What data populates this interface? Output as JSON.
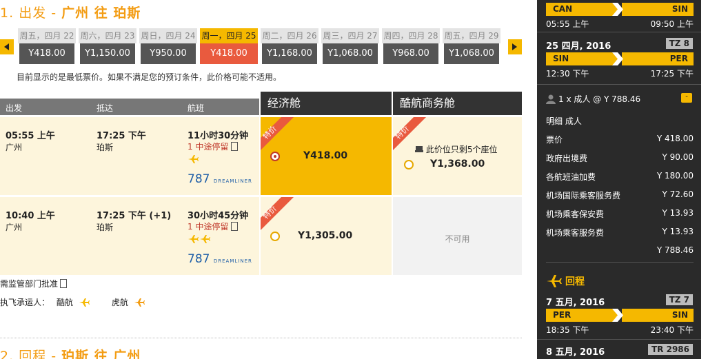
{
  "outbound": {
    "num": "1.",
    "label": "出发 - ",
    "route": "广州 往 珀斯",
    "dates": [
      {
        "day": "周五，四月 22",
        "price": "Y418.00",
        "selected": false
      },
      {
        "day": "周六，四月 23",
        "price": "Y1,150.00",
        "selected": false
      },
      {
        "day": "周日，四月 24",
        "price": "Y950.00",
        "selected": false
      },
      {
        "day": "周一，四月 25",
        "price": "Y418.00",
        "selected": true
      },
      {
        "day": "周二，四月 26",
        "price": "Y1,168.00",
        "selected": false
      },
      {
        "day": "周三，四月 27",
        "price": "Y1,068.00",
        "selected": false
      },
      {
        "day": "周四，四月 28",
        "price": "Y968.00",
        "selected": false
      },
      {
        "day": "周五，四月 29",
        "price": "Y1,068.00",
        "selected": false
      }
    ],
    "notice": "目前显示的是最低票价。如果不满足您的预订条件，此价格可能不适用。"
  },
  "table": {
    "col_depart": "出发",
    "col_arrive": "抵达",
    "col_flight": "航班",
    "economy_header": "经济舱",
    "business_header": "酷航商务舱",
    "special_tag": "特价",
    "flights": [
      {
        "dep_time": "05:55 上午",
        "dep_city": "广州",
        "arr_time": "17:25 下午",
        "arr_city": "珀斯",
        "duration": "11小时30分钟",
        "stops": "1 中途停留",
        "aircraft_num": "787",
        "aircraft_name": "DREAMLINER",
        "economy_price": "Y418.00",
        "business_price": "Y1,368.00",
        "business_note": "此价位只剩5个座位"
      },
      {
        "dep_time": "10:40 上午",
        "dep_city": "广州",
        "arr_time": "17:25 下午 (+1)",
        "arr_city": "珀斯",
        "duration": "30小时45分钟",
        "stops": "1 中途停留",
        "aircraft_num": "787",
        "aircraft_name": "DREAMLINER",
        "economy_price": "Y1,305.00",
        "business_na": "不可用"
      }
    ]
  },
  "regulatory": "需监管部门批准",
  "carriers": {
    "label": "执飞承运人：",
    "items": [
      "酷航",
      "虎航"
    ]
  },
  "return": {
    "num": "2.",
    "label": "回程 - ",
    "route": "珀斯 往 广州"
  },
  "sidebar": {
    "seg1": {
      "from": "CAN",
      "to": "SIN",
      "dep": "05:55 上午",
      "arr": "09:50 上午"
    },
    "date2": "25 四月, 2016",
    "code2": "TZ 8",
    "seg2": {
      "from": "SIN",
      "to": "PER",
      "dep": "12:30 下午",
      "arr": "17:25 下午"
    },
    "pax": "1 x 成人 @ Y 788.46",
    "toggle": "-",
    "breakdown_title": "明细 成人",
    "breakdown": [
      {
        "label": "票价",
        "value": "Y 418.00"
      },
      {
        "label": "政府出境费",
        "value": "Y 90.00"
      },
      {
        "label": "各航班油加费",
        "value": "Y 180.00"
      },
      {
        "label": "机场国际乘客服务费",
        "value": "Y 72.60"
      },
      {
        "label": "机场乘客保安费",
        "value": "Y 13.93"
      },
      {
        "label": "机场乘客服务费",
        "value": "Y 13.93"
      }
    ],
    "total": "Y 788.46",
    "return_title": "回程",
    "ret_date1": "7 五月, 2016",
    "ret_code1": "TZ 7",
    "ret_seg1": {
      "from": "PER",
      "to": "SIN",
      "dep": "18:35 下午",
      "arr": "23:40 下午"
    },
    "ret_date2": "8 五月, 2016",
    "ret_code2": "TR 2986"
  },
  "colors": {
    "accent": "#f5b800",
    "title": "#f39c12",
    "selected_price": "#e95a3e",
    "sidebar_bg": "#2a2a2a"
  }
}
